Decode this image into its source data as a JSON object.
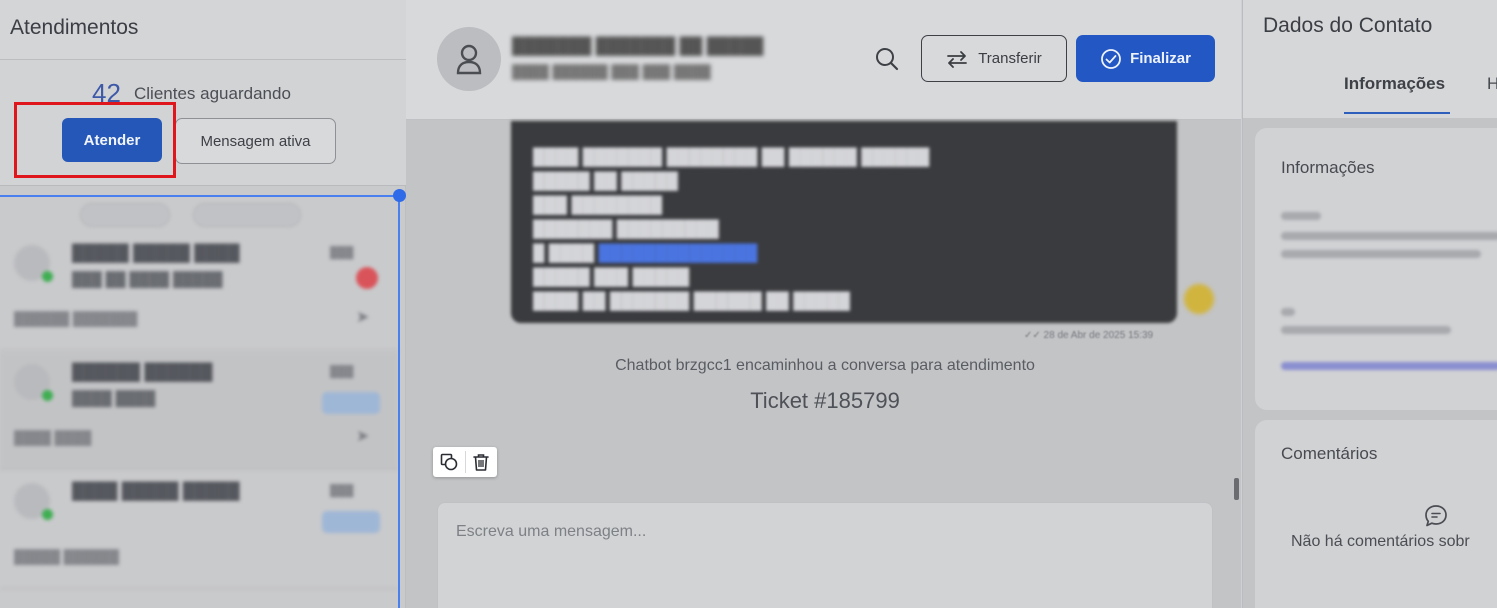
{
  "left": {
    "title": "Atendimentos",
    "waiting_count": "42",
    "waiting_label": "Clientes aguardando",
    "attend_button": "Atender",
    "active_message_button": "Mensagem ativa",
    "highlight_color": "#e0161d",
    "selection_color": "#2f6ae8"
  },
  "center": {
    "system_message": "Chatbot brzgcc1 encaminhou a conversa para atendimento",
    "ticket": "Ticket #185799",
    "transfer_button": "Transferir",
    "finish_button": "Finalizar",
    "bubble_time": "28 de Abr de 2025 15:39",
    "message_placeholder": "Escreva uma mensagem...",
    "accent_color": "#2257c4"
  },
  "right": {
    "title": "Dados do Contato",
    "tab_info": "Informações",
    "tab_other": "H",
    "info_card_title": "Informações",
    "comments_title": "Comentários",
    "no_comments": "Não há comentários sobr"
  }
}
